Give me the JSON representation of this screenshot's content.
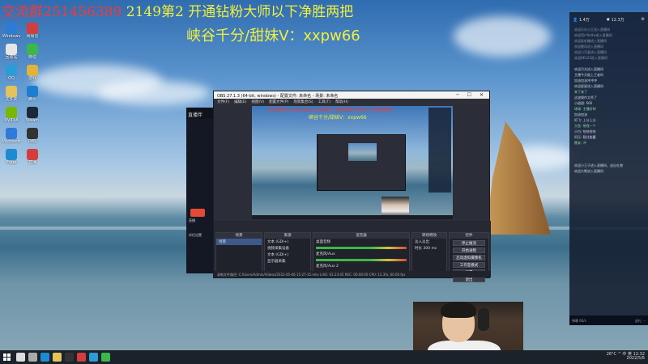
{
  "overlay": {
    "top_left_red": "交流群251456389",
    "top_left_yellow": " 2149第2 开通钻粉大师以下净胜两把",
    "subtitle": "峡谷千分/甜妹V：xxpw66"
  },
  "desktop_icons": [
    {
      "label": "Windows",
      "color": "#2d7bd6"
    },
    {
      "label": "网易云",
      "color": "#d33d3d"
    },
    {
      "label": "回收站",
      "color": "#e6e6e6"
    },
    {
      "label": "微信",
      "color": "#3cb84a"
    },
    {
      "label": "QQ",
      "color": "#2d9bd6"
    },
    {
      "label": "游戏",
      "color": "#e0b33c"
    },
    {
      "label": "文件夹",
      "color": "#e6c25a"
    },
    {
      "label": "腾讯",
      "color": "#1a7fd0"
    },
    {
      "label": "NVIDIA",
      "color": "#76b900"
    },
    {
      "label": "Steam",
      "color": "#1b2838"
    },
    {
      "label": "Microsoft",
      "color": "#2d7bd6"
    },
    {
      "label": "OBS",
      "color": "#333"
    },
    {
      "label": "Edge",
      "color": "#1e8bd0"
    },
    {
      "label": "直播",
      "color": "#d33d3d"
    }
  ],
  "zhibo": {
    "title": "直播伴",
    "btn_label": "直播",
    "label2": "伴侣设置"
  },
  "obs": {
    "title": "OBS 27.1.3 (64-bit, windows) - 配置文件: 未命名 - 场景: 未命名",
    "window_controls": "─ ☐ ✕",
    "menu": [
      "文件(F)",
      "编辑(E)",
      "视图(V)",
      "配置文件(P)",
      "场景集合(S)",
      "工具(T)",
      "帮助(H)"
    ],
    "preview_text_red": "交流群251456389 2149第2 开通钻粉大师以下净胜两把",
    "preview_text_yellow": "峡谷千分/甜妹V：xxpw66",
    "docks": {
      "scenes": {
        "title": "场景",
        "items": [
          "场景"
        ]
      },
      "sources": {
        "title": "来源",
        "items": [
          "文本 (GDI+)",
          "视频采集设备",
          "文本 (GDI+)",
          "显示器采集"
        ]
      },
      "mixer": {
        "title": "混音器",
        "items": [
          "桌面音频",
          "麦克风/Aux",
          "麦克风/Aux 2"
        ]
      },
      "transitions": {
        "title": "转场特效",
        "items": [
          "淡入淡出",
          "时长 300 ms"
        ]
      },
      "controls": {
        "title": "控件",
        "items": [
          "停止推流",
          "开始录制",
          "启动虚拟摄像机",
          "工作室模式",
          "设置",
          "退出"
        ]
      }
    },
    "scene_label": "场景选择",
    "status": "录制文件路径: C:/Users/Admin/Videos/2022-05-06 15-27-35.mkv    LIVE: 01:23:45   REC: 00:00:00   CPU: 12.3%, 60.00 fps"
  },
  "chat": {
    "header_left": "👤 1.4万",
    "header_mid": "♥ 12.3万",
    "header_right": "⚙",
    "messages": [
      {
        "text": "欢迎乐乐小王进入直播间",
        "kind": "dim"
      },
      {
        "text": "欢迎用户8x9w进入直播间",
        "kind": "dim"
      },
      {
        "text": "欢迎彩虹糖进入直播间",
        "kind": "dim"
      },
      {
        "text": "欢迎晚风进入直播间",
        "kind": "dim"
      },
      {
        "text": "欢迎小可爱进入直播间",
        "kind": "dim"
      },
      {
        "text": "欢迎KK123进入直播间",
        "kind": "dim"
      },
      {
        "text": "",
        "kind": "dim"
      },
      {
        "text": "欢迎月光进入直播间",
        "kind": "n"
      },
      {
        "text": "主播今天能上王者吗",
        "kind": "n"
      },
      {
        "text": "加油加油冲冲冲",
        "kind": "n"
      },
      {
        "text": "欢迎星星进入直播间",
        "kind": "n"
      },
      {
        "text": "来了来了",
        "kind": "g"
      },
      {
        "text": "这波操作太秀了",
        "kind": "n"
      },
      {
        "text": "小甜甜: 666",
        "kind": "n"
      },
      {
        "text": "球球: 主播好帅",
        "kind": "g"
      },
      {
        "text": "加油加油",
        "kind": "n"
      },
      {
        "text": "阿飞: 上分上分",
        "kind": "n"
      },
      {
        "text": "大鱼: 带我一个",
        "kind": "g"
      },
      {
        "text": "小白: 哈哈哈哈",
        "kind": "n"
      },
      {
        "text": "阿乐: 稳住能赢",
        "kind": "n"
      },
      {
        "text": "晚安: 冲",
        "kind": "g"
      },
      {
        "text": "",
        "kind": "n"
      },
      {
        "text": "",
        "kind": "n"
      },
      {
        "text": "",
        "kind": "n"
      },
      {
        "text": "欢迎小王子进入直播间，送出礼物",
        "kind": "n"
      },
      {
        "text": "欢迎大熊进入直播间",
        "kind": "n"
      }
    ],
    "footer_left": "弹幕 66/s",
    "footer_right": "送礼 ⋯"
  },
  "taskbar": {
    "apps": [
      {
        "name": "search",
        "color": "#ddd"
      },
      {
        "name": "taskview",
        "color": "#aaa"
      },
      {
        "name": "edge",
        "color": "#1e8bd0"
      },
      {
        "name": "folder",
        "color": "#e6c25a"
      },
      {
        "name": "obs",
        "color": "#333"
      },
      {
        "name": "zhibo",
        "color": "#d33d3d"
      },
      {
        "name": "qq",
        "color": "#2d9bd6"
      },
      {
        "name": "wechat",
        "color": "#3cb84a"
      }
    ],
    "tray_line1": "26°C  ^  中  英   12:32",
    "tray_line2": "2022/5/6"
  }
}
